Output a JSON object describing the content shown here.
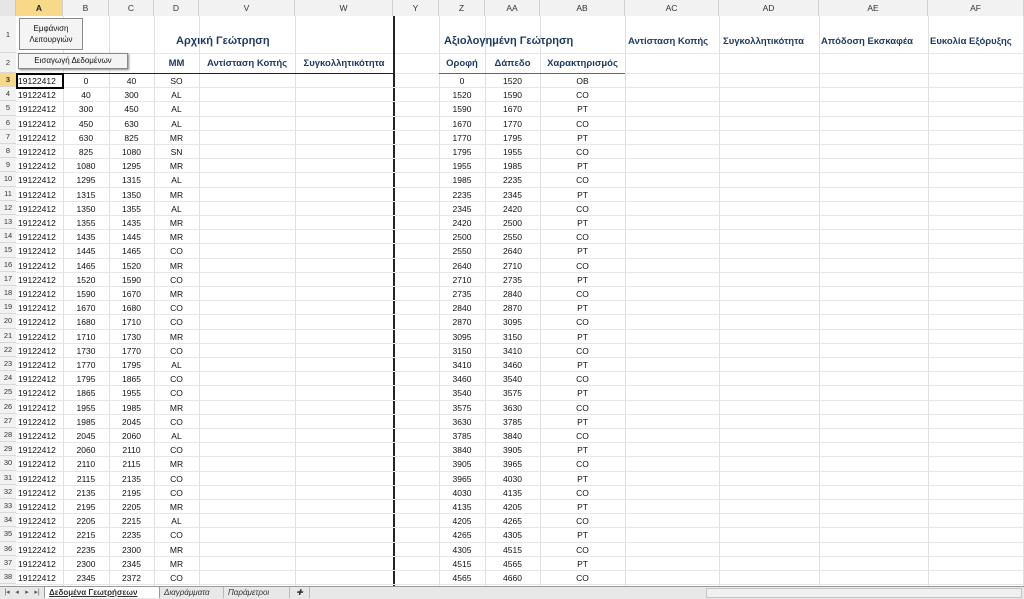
{
  "columns": [
    "A",
    "B",
    "C",
    "D",
    "V",
    "W",
    "",
    "Y",
    "Z",
    "AA",
    "AB",
    "AC",
    "AD",
    "AE",
    "AF"
  ],
  "selected_column": "A",
  "selected_row": "3",
  "buttons": {
    "show_functions_line1": "Εμφάνιση",
    "show_functions_line2": "Λειτουργιών",
    "import_data": "Εισαγωγή Δεδομένων"
  },
  "titles": {
    "initial_drilling": "Αρχική Γεώτρηση",
    "evaluated_drilling": "Αξιολογημένη Γεώτρηση"
  },
  "headers": {
    "mm": "ΜΜ",
    "cutting_resistance": "Αντίσταση Κοπής",
    "cohesion": "Συγκολλητικότητα",
    "roof": "Οροφή",
    "floor": "Δάπεδο",
    "characterization": "Χαρακτηρισμός",
    "ac": "Αντίσταση Κοπής",
    "ad": "Συγκολλητικότητα",
    "ae": "Απόδοση Εκσκαφέα",
    "af": "Ευκολία Εξόρυξης"
  },
  "rows": [
    {
      "n": "3",
      "a": "19122412",
      "b": "0",
      "c": "40",
      "d": "SO",
      "z": "0",
      "aa": "1520",
      "ab": "OB"
    },
    {
      "n": "4",
      "a": "19122412",
      "b": "40",
      "c": "300",
      "d": "AL",
      "z": "1520",
      "aa": "1590",
      "ab": "CO"
    },
    {
      "n": "5",
      "a": "19122412",
      "b": "300",
      "c": "450",
      "d": "AL",
      "z": "1590",
      "aa": "1670",
      "ab": "PT"
    },
    {
      "n": "6",
      "a": "19122412",
      "b": "450",
      "c": "630",
      "d": "AL",
      "z": "1670",
      "aa": "1770",
      "ab": "CO"
    },
    {
      "n": "7",
      "a": "19122412",
      "b": "630",
      "c": "825",
      "d": "MR",
      "z": "1770",
      "aa": "1795",
      "ab": "PT"
    },
    {
      "n": "8",
      "a": "19122412",
      "b": "825",
      "c": "1080",
      "d": "SN",
      "z": "1795",
      "aa": "1955",
      "ab": "CO"
    },
    {
      "n": "9",
      "a": "19122412",
      "b": "1080",
      "c": "1295",
      "d": "MR",
      "z": "1955",
      "aa": "1985",
      "ab": "PT"
    },
    {
      "n": "10",
      "a": "19122412",
      "b": "1295",
      "c": "1315",
      "d": "AL",
      "z": "1985",
      "aa": "2235",
      "ab": "CO"
    },
    {
      "n": "11",
      "a": "19122412",
      "b": "1315",
      "c": "1350",
      "d": "MR",
      "z": "2235",
      "aa": "2345",
      "ab": "PT"
    },
    {
      "n": "12",
      "a": "19122412",
      "b": "1350",
      "c": "1355",
      "d": "AL",
      "z": "2345",
      "aa": "2420",
      "ab": "CO"
    },
    {
      "n": "13",
      "a": "19122412",
      "b": "1355",
      "c": "1435",
      "d": "MR",
      "z": "2420",
      "aa": "2500",
      "ab": "PT"
    },
    {
      "n": "14",
      "a": "19122412",
      "b": "1435",
      "c": "1445",
      "d": "MR",
      "z": "2500",
      "aa": "2550",
      "ab": "CO"
    },
    {
      "n": "15",
      "a": "19122412",
      "b": "1445",
      "c": "1465",
      "d": "CO",
      "z": "2550",
      "aa": "2640",
      "ab": "PT"
    },
    {
      "n": "16",
      "a": "19122412",
      "b": "1465",
      "c": "1520",
      "d": "MR",
      "z": "2640",
      "aa": "2710",
      "ab": "CO"
    },
    {
      "n": "17",
      "a": "19122412",
      "b": "1520",
      "c": "1590",
      "d": "CO",
      "z": "2710",
      "aa": "2735",
      "ab": "PT"
    },
    {
      "n": "18",
      "a": "19122412",
      "b": "1590",
      "c": "1670",
      "d": "MR",
      "z": "2735",
      "aa": "2840",
      "ab": "CO"
    },
    {
      "n": "19",
      "a": "19122412",
      "b": "1670",
      "c": "1680",
      "d": "CO",
      "z": "2840",
      "aa": "2870",
      "ab": "PT"
    },
    {
      "n": "20",
      "a": "19122412",
      "b": "1680",
      "c": "1710",
      "d": "CO",
      "z": "2870",
      "aa": "3095",
      "ab": "CO"
    },
    {
      "n": "21",
      "a": "19122412",
      "b": "1710",
      "c": "1730",
      "d": "MR",
      "z": "3095",
      "aa": "3150",
      "ab": "PT"
    },
    {
      "n": "22",
      "a": "19122412",
      "b": "1730",
      "c": "1770",
      "d": "CO",
      "z": "3150",
      "aa": "3410",
      "ab": "CO"
    },
    {
      "n": "23",
      "a": "19122412",
      "b": "1770",
      "c": "1795",
      "d": "AL",
      "z": "3410",
      "aa": "3460",
      "ab": "PT"
    },
    {
      "n": "24",
      "a": "19122412",
      "b": "1795",
      "c": "1865",
      "d": "CO",
      "z": "3460",
      "aa": "3540",
      "ab": "CO"
    },
    {
      "n": "25",
      "a": "19122412",
      "b": "1865",
      "c": "1955",
      "d": "CO",
      "z": "3540",
      "aa": "3575",
      "ab": "PT"
    },
    {
      "n": "26",
      "a": "19122412",
      "b": "1955",
      "c": "1985",
      "d": "MR",
      "z": "3575",
      "aa": "3630",
      "ab": "CO"
    },
    {
      "n": "27",
      "a": "19122412",
      "b": "1985",
      "c": "2045",
      "d": "CO",
      "z": "3630",
      "aa": "3785",
      "ab": "PT"
    },
    {
      "n": "28",
      "a": "19122412",
      "b": "2045",
      "c": "2060",
      "d": "AL",
      "z": "3785",
      "aa": "3840",
      "ab": "CO"
    },
    {
      "n": "29",
      "a": "19122412",
      "b": "2060",
      "c": "2110",
      "d": "CO",
      "z": "3840",
      "aa": "3905",
      "ab": "PT"
    },
    {
      "n": "30",
      "a": "19122412",
      "b": "2110",
      "c": "2115",
      "d": "MR",
      "z": "3905",
      "aa": "3965",
      "ab": "CO"
    },
    {
      "n": "31",
      "a": "19122412",
      "b": "2115",
      "c": "2135",
      "d": "CO",
      "z": "3965",
      "aa": "4030",
      "ab": "PT"
    },
    {
      "n": "32",
      "a": "19122412",
      "b": "2135",
      "c": "2195",
      "d": "CO",
      "z": "4030",
      "aa": "4135",
      "ab": "CO"
    },
    {
      "n": "33",
      "a": "19122412",
      "b": "2195",
      "c": "2205",
      "d": "MR",
      "z": "4135",
      "aa": "4205",
      "ab": "PT"
    },
    {
      "n": "34",
      "a": "19122412",
      "b": "2205",
      "c": "2215",
      "d": "AL",
      "z": "4205",
      "aa": "4265",
      "ab": "CO"
    },
    {
      "n": "35",
      "a": "19122412",
      "b": "2215",
      "c": "2235",
      "d": "CO",
      "z": "4265",
      "aa": "4305",
      "ab": "PT"
    },
    {
      "n": "36",
      "a": "19122412",
      "b": "2235",
      "c": "2300",
      "d": "MR",
      "z": "4305",
      "aa": "4515",
      "ab": "CO"
    },
    {
      "n": "37",
      "a": "19122412",
      "b": "2300",
      "c": "2345",
      "d": "MR",
      "z": "4515",
      "aa": "4565",
      "ab": "PT"
    },
    {
      "n": "38",
      "a": "19122412",
      "b": "2345",
      "c": "2372",
      "d": "CO",
      "z": "4565",
      "aa": "4660",
      "ab": "CO"
    }
  ],
  "sheet_tabs": [
    "Δεδομένα Γεωτρήσεων",
    "Διαγράμματα",
    "Παράμετροι"
  ],
  "active_tab": 0,
  "icons": {
    "nav_first": "first-sheet-icon",
    "nav_prev": "prev-sheet-icon",
    "nav_next": "next-sheet-icon",
    "nav_last": "last-sheet-icon",
    "new_sheet": "new-sheet-icon"
  }
}
